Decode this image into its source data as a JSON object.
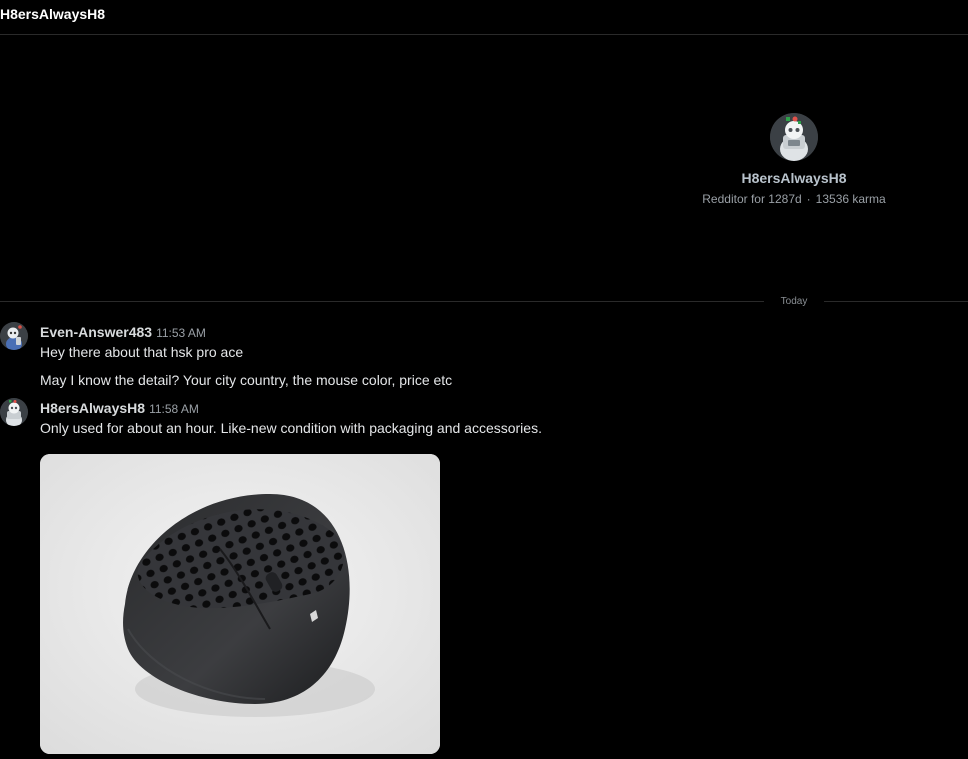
{
  "header": {
    "title": "H8ersAlwaysH8"
  },
  "profile": {
    "name": "H8ersAlwaysH8",
    "age": "Redditor for 1287d",
    "separator": "·",
    "karma": "13536 karma",
    "avatar_icon": "snoo-avatar-icon"
  },
  "date_divider": {
    "label": "Today"
  },
  "messages": [
    {
      "author": "Even-Answer483",
      "time": "11:53 AM",
      "avatar_icon": "snoo-avatar-icon",
      "lines": [
        "Hey there about that hsk pro ace",
        "May I know the detail? Your city country, the mouse color, price etc"
      ]
    },
    {
      "author": "H8ersAlwaysH8",
      "time": "11:58 AM",
      "avatar_icon": "snoo-avatar-icon",
      "lines": [
        "Only used for about an hour. Like-new condition with packaging and accessories."
      ],
      "image": "gaming-mouse-photo"
    }
  ],
  "colors": {
    "background": "#000000",
    "divider": "#2a2a2a",
    "muted_text": "#9aa0a6"
  }
}
